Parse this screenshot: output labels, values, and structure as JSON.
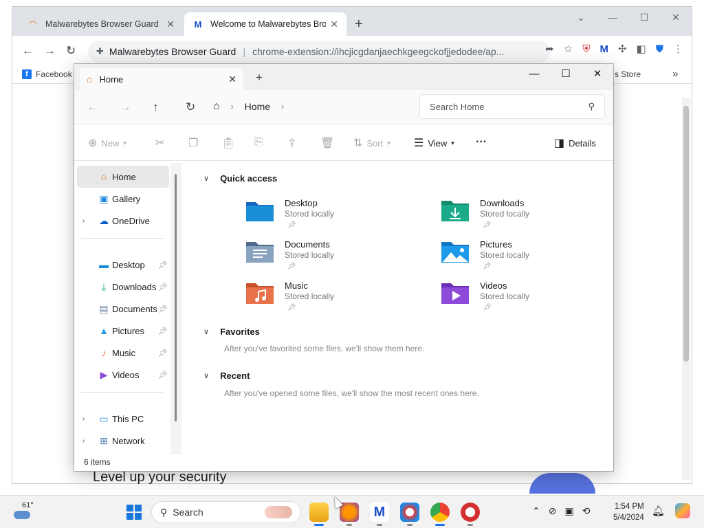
{
  "browser": {
    "tabs": [
      {
        "title": "Malwarebytes Browser Guard",
        "active": false
      },
      {
        "title": "Welcome to Malwarebytes Brow",
        "active": true
      }
    ],
    "omnibox_name": "Malwarebytes Browser Guard",
    "omnibox_url": "chrome-extension://ihcjicgdanjaechkgeegckofjjedodee/ap...",
    "bookmarks": {
      "facebook": "Facebook",
      "store": "s Store"
    },
    "page_heading": "Level up your security"
  },
  "explorer": {
    "tab_title": "Home",
    "breadcrumb": "Home",
    "search_placeholder": "Search Home",
    "commands": {
      "new": "New",
      "sort": "Sort",
      "view": "View",
      "details": "Details"
    },
    "sidebar": {
      "top": [
        {
          "label": "Home",
          "icon": "home-icon"
        },
        {
          "label": "Gallery",
          "icon": "gallery-icon"
        },
        {
          "label": "OneDrive",
          "icon": "onedrive-icon"
        }
      ],
      "pinned": [
        {
          "label": "Desktop",
          "icon": "desktop-folder-icon"
        },
        {
          "label": "Downloads",
          "icon": "downloads-folder-icon"
        },
        {
          "label": "Documents",
          "icon": "documents-folder-icon"
        },
        {
          "label": "Pictures",
          "icon": "pictures-folder-icon"
        },
        {
          "label": "Music",
          "icon": "music-folder-icon"
        },
        {
          "label": "Videos",
          "icon": "videos-folder-icon"
        }
      ],
      "bottom": [
        {
          "label": "This PC",
          "icon": "this-pc-icon"
        },
        {
          "label": "Network",
          "icon": "network-icon"
        }
      ]
    },
    "quick_access": {
      "heading": "Quick access",
      "items": [
        {
          "name": "Desktop",
          "sub": "Stored locally",
          "color": "#1a8fd8"
        },
        {
          "name": "Downloads",
          "sub": "Stored locally",
          "color": "#1bab8a"
        },
        {
          "name": "Documents",
          "sub": "Stored locally",
          "color": "#6b87a8"
        },
        {
          "name": "Pictures",
          "sub": "Stored locally",
          "color": "#1e9be8"
        },
        {
          "name": "Music",
          "sub": "Stored locally",
          "color": "#e8724a"
        },
        {
          "name": "Videos",
          "sub": "Stored locally",
          "color": "#8d4ad8"
        }
      ]
    },
    "favorites": {
      "heading": "Favorites",
      "note": "After you've favorited some files, we'll show them here."
    },
    "recent": {
      "heading": "Recent",
      "note": "After you've opened some files, we'll show the most recent ones here."
    },
    "status": "6 items"
  },
  "taskbar": {
    "weather": "61°",
    "search_label": "Search",
    "time": "1:54 PM",
    "date": "5/4/2024"
  }
}
